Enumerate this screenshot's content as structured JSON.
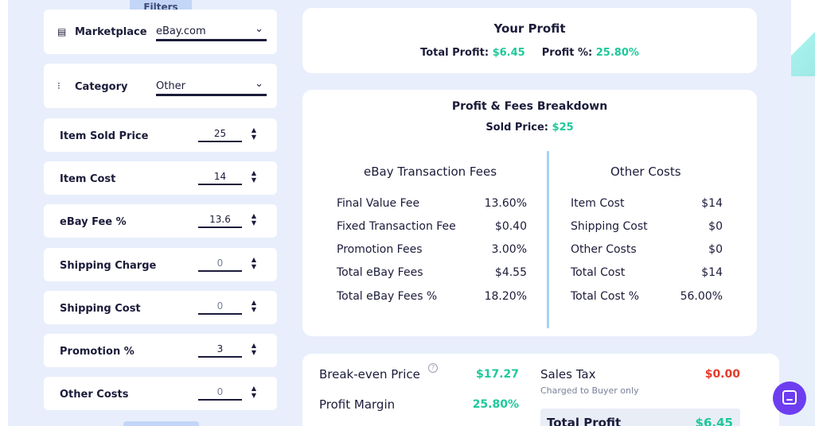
{
  "filters": {
    "tab_label": "Filters",
    "marketplace": {
      "label": "Marketplace",
      "value": "eBay.com",
      "icon": "store-icon"
    },
    "category": {
      "label": "Category",
      "value": "Other",
      "icon": "category-icon"
    },
    "inputs": [
      {
        "label": "Item Sold Price",
        "value": "25"
      },
      {
        "label": "Item Cost",
        "value": "14"
      },
      {
        "label": "eBay Fee %",
        "value": "13.6"
      },
      {
        "label": "Shipping Charge",
        "value": "0"
      },
      {
        "label": "Shipping Cost",
        "value": "0"
      },
      {
        "label": "Promotion %",
        "value": "3"
      },
      {
        "label": "Other Costs",
        "value": "0"
      }
    ]
  },
  "profit": {
    "title": "Your Profit",
    "total_label": "Total Profit:",
    "total_value": "$6.45",
    "percent_label": "Profit %:",
    "percent_value": "25.80%"
  },
  "breakdown": {
    "title": "Profit & Fees Breakdown",
    "sold_label": "Sold Price:",
    "sold_value": "$25",
    "fees_title": "eBay Transaction Fees",
    "fees": [
      {
        "label": "Final Value Fee",
        "value": "13.60%"
      },
      {
        "label": "Fixed Transaction Fee",
        "value": "$0.40"
      },
      {
        "label": "Promotion Fees",
        "value": "3.00%"
      },
      {
        "label": "Total eBay Fees",
        "value": "$4.55"
      },
      {
        "label": "Total eBay Fees %",
        "value": "18.20%"
      }
    ],
    "costs_title": "Other Costs",
    "costs": [
      {
        "label": "Item Cost",
        "value": "$14"
      },
      {
        "label": "Shipping Cost",
        "value": "$0"
      },
      {
        "label": "Other Costs",
        "value": "$0"
      },
      {
        "label": "Total Cost",
        "value": "$14"
      },
      {
        "label": "Total Cost %",
        "value": "56.00%"
      }
    ]
  },
  "summary": {
    "breakeven_label": "Break-even Price",
    "breakeven_value": "$17.27",
    "margin_label": "Profit Margin",
    "margin_value": "25.80%",
    "tax_label": "Sales Tax",
    "tax_value": "$0.00",
    "tax_note": "Charged to Buyer only",
    "total_label": "Total Profit",
    "total_value": "$6.45"
  },
  "colors": {
    "accent_green": "#1ec99a",
    "accent_red": "#e23b2a",
    "chat_purple": "#6d3df0"
  }
}
